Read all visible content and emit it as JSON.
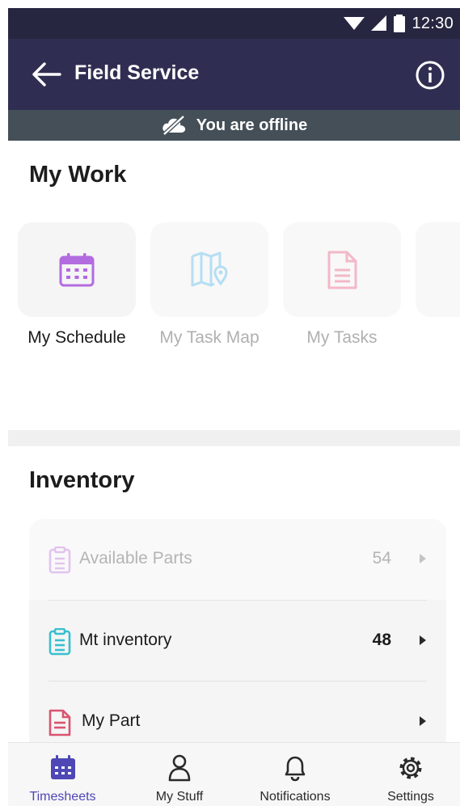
{
  "status_bar": {
    "time": "12:30"
  },
  "app_bar": {
    "title": "Field Service"
  },
  "offline_banner": {
    "text": "You are offline"
  },
  "my_work": {
    "title": "My Work",
    "tiles": [
      {
        "label": "My Schedule",
        "icon": "calendar-icon",
        "color": "#b36be0",
        "enabled": true
      },
      {
        "label": "My Task Map",
        "icon": "map-pin-icon",
        "color": "#b5def3",
        "enabled": false
      },
      {
        "label": "My Tasks",
        "icon": "document-icon",
        "color": "#f3b7c8",
        "enabled": false
      }
    ]
  },
  "inventory": {
    "title": "Inventory",
    "rows": [
      {
        "label": "Available Parts",
        "count": "54",
        "icon": "clipboard-icon",
        "icon_color": "#e2c3f0",
        "enabled": false
      },
      {
        "label": "Mt inventory",
        "count": "48",
        "icon": "clipboard-icon",
        "icon_color": "#37bfd0",
        "enabled": true
      },
      {
        "label": "My Part",
        "count": "",
        "icon": "document-icon",
        "icon_color": "#d9546f",
        "enabled": true
      }
    ]
  },
  "bottom_nav": {
    "items": [
      {
        "label": "Timesheets",
        "icon": "calendar-icon",
        "active": true
      },
      {
        "label": "My Stuff",
        "icon": "person-icon",
        "active": false
      },
      {
        "label": "Notifications",
        "icon": "bell-icon",
        "active": false
      },
      {
        "label": "Settings",
        "icon": "gear-icon",
        "active": false
      }
    ]
  },
  "colors": {
    "status_bar": "#262641",
    "app_bar": "#2f2e52",
    "offline_banner": "#454f57",
    "nav_active": "#4e47b5",
    "text_dark": "#1c1c1c",
    "text_muted": "#b0b0b0"
  }
}
